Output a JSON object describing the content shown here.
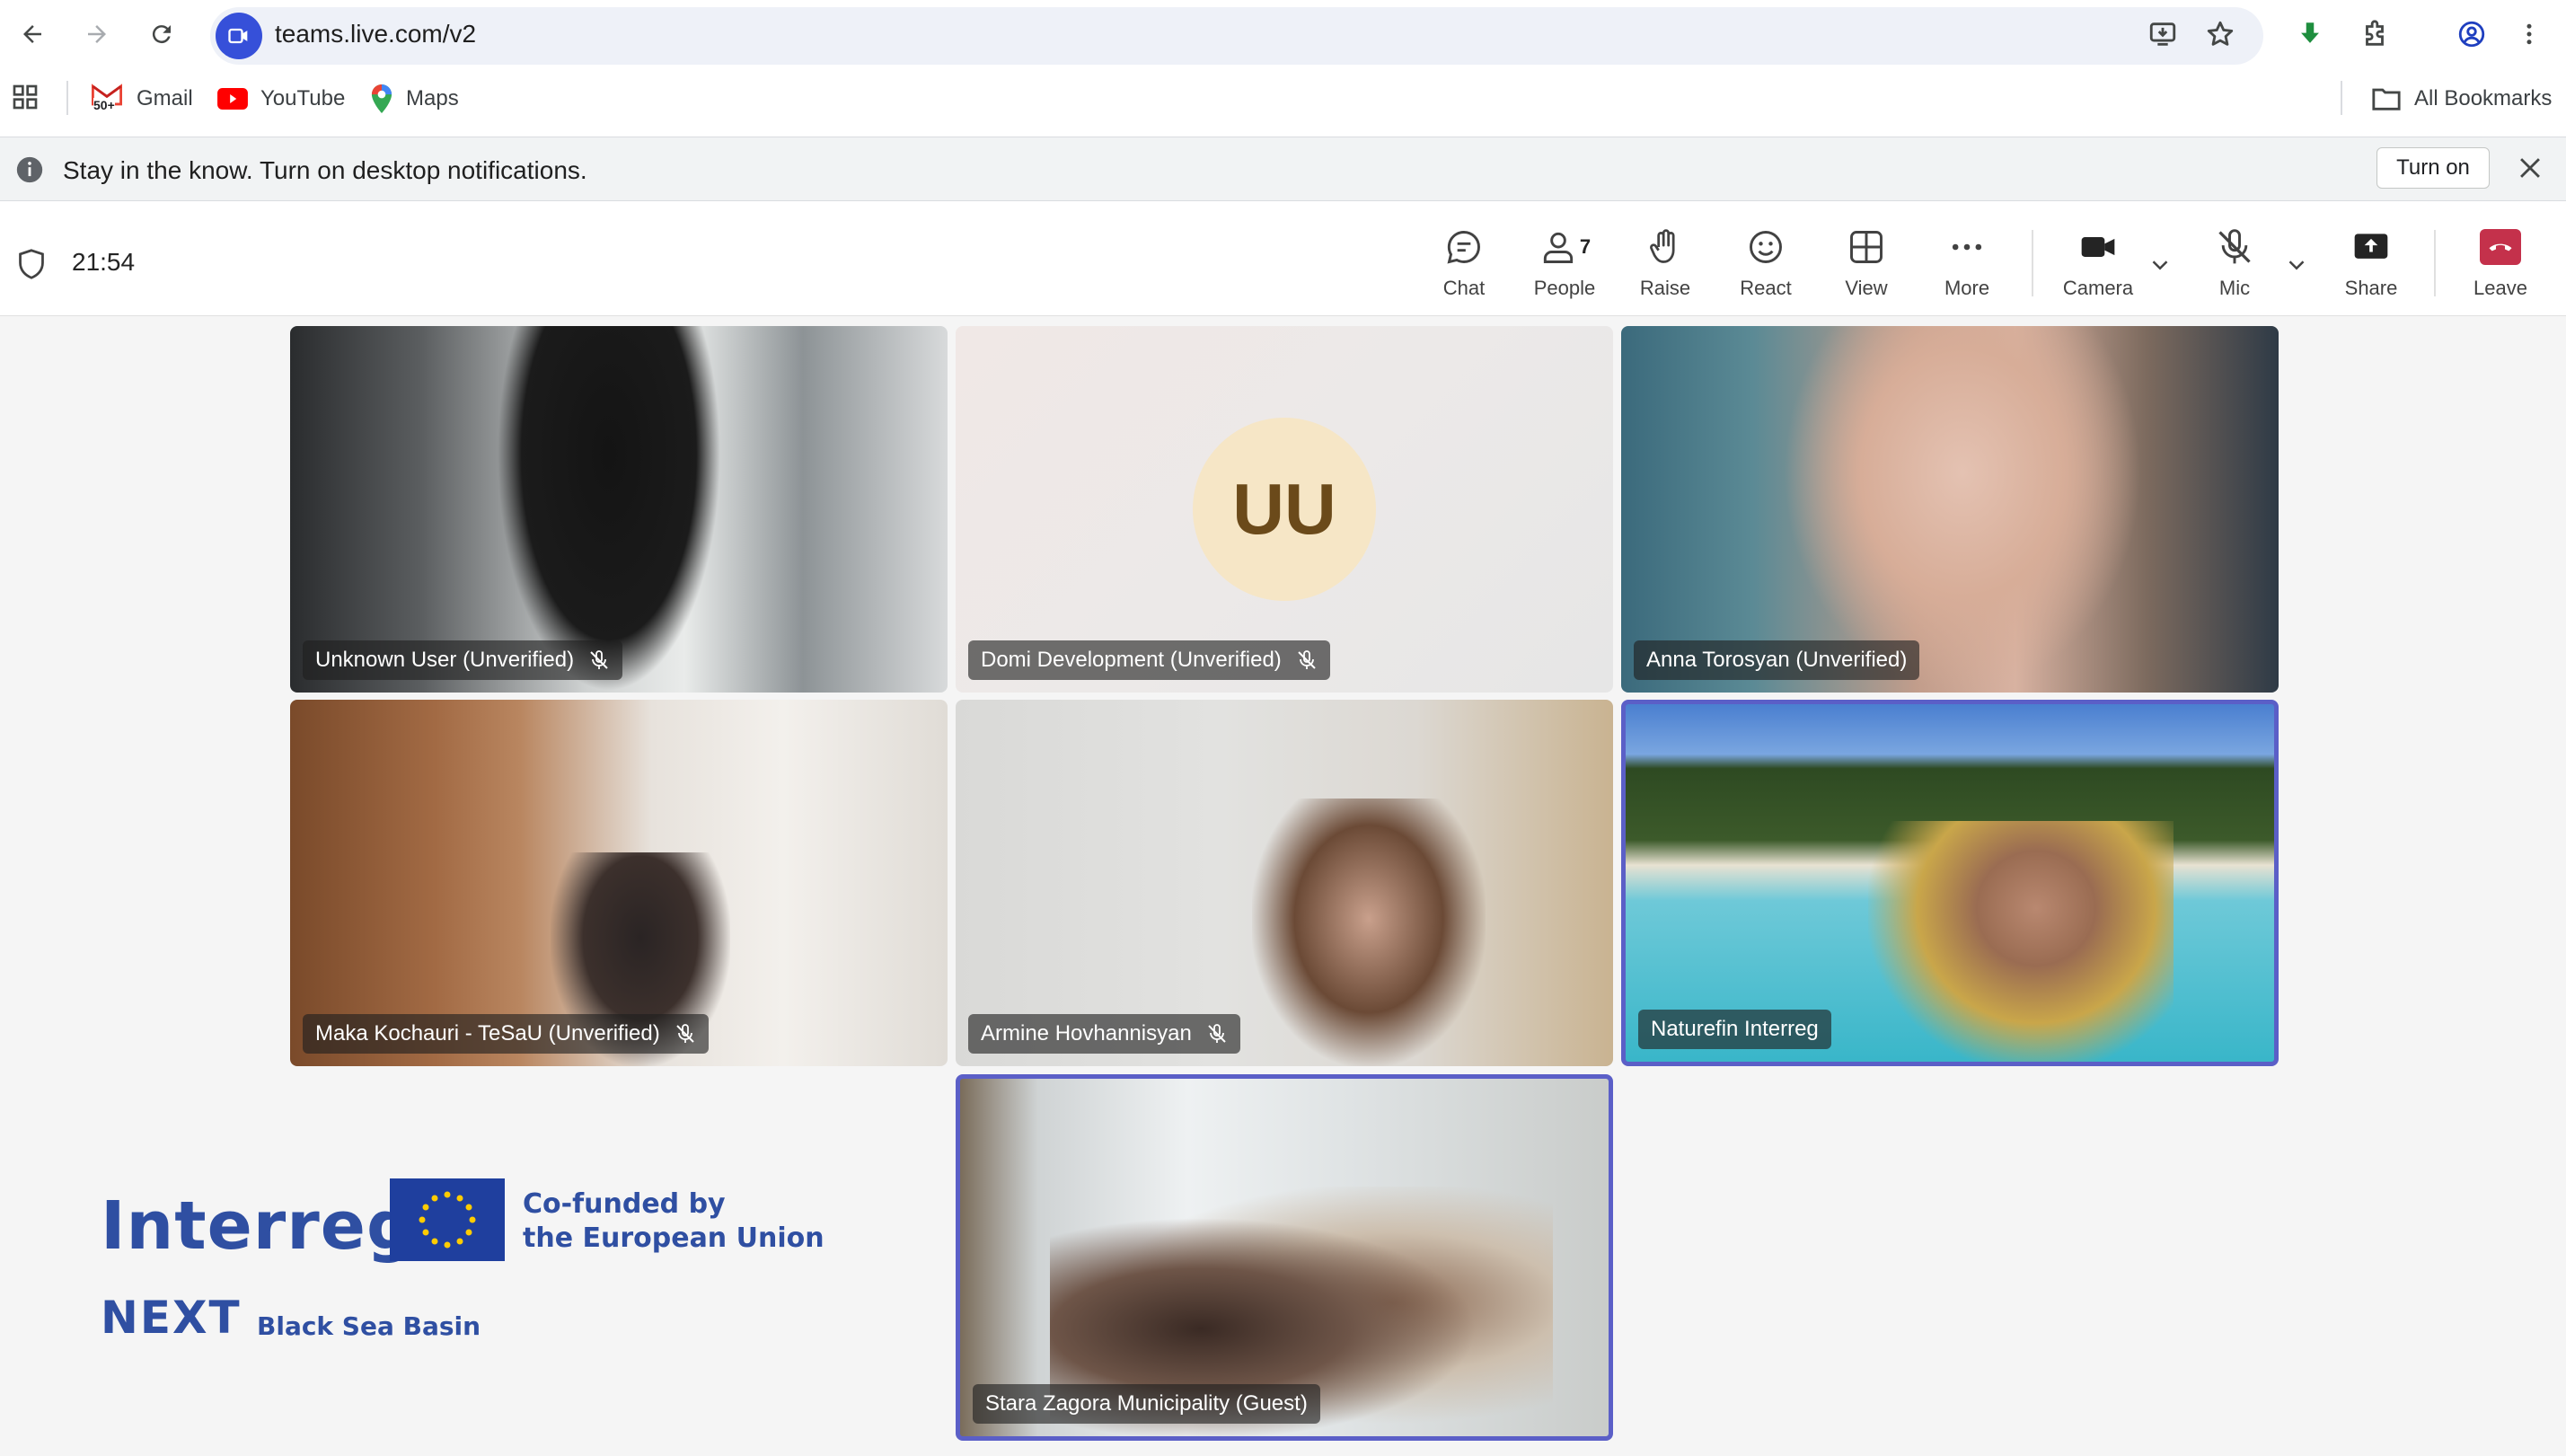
{
  "browser": {
    "url": "teams.live.com/v2",
    "bookmarks": [
      {
        "label": "Gmail",
        "icon": "gmail-icon"
      },
      {
        "label": "YouTube",
        "icon": "youtube-icon"
      },
      {
        "label": "Maps",
        "icon": "maps-icon"
      }
    ],
    "all_bookmarks_label": "All Bookmarks",
    "gmail_badge": "50+"
  },
  "notification": {
    "text": "Stay in the know. Turn on desktop notifications.",
    "button_label": "Turn on"
  },
  "meeting": {
    "elapsed": "21:54",
    "toolbar": {
      "chat": "Chat",
      "people": "People",
      "people_count": "7",
      "raise": "Raise",
      "react": "React",
      "view": "View",
      "more": "More",
      "camera": "Camera",
      "mic": "Mic",
      "share": "Share",
      "leave": "Leave"
    },
    "participants": [
      {
        "name": "Unknown User (Unverified)",
        "muted": true
      },
      {
        "name": "Domi Development (Unverified)",
        "muted": true,
        "initials": "UU"
      },
      {
        "name": "Anna Torosyan (Unverified)",
        "muted": false
      },
      {
        "name": "Maka Kochauri - TeSaU (Unverified)",
        "muted": true
      },
      {
        "name": "Armine Hovhannisyan",
        "muted": true
      },
      {
        "name": "Naturefin Interreg",
        "muted": false
      },
      {
        "name": "Stara Zagora Municipality (Guest)",
        "muted": false
      }
    ]
  },
  "branding": {
    "interreg": "Interreg",
    "cofunded_line1": "Co-funded by",
    "cofunded_line2": "the European Union",
    "next": "NEXT",
    "region": "Black Sea Basin"
  },
  "colors": {
    "teams_accent": "#5b5fc7",
    "leave_red": "#c4314b",
    "chrome_blue": "#3650d9",
    "interreg_blue": "#2f4fa2",
    "eu_blue": "#1f3f9e"
  }
}
